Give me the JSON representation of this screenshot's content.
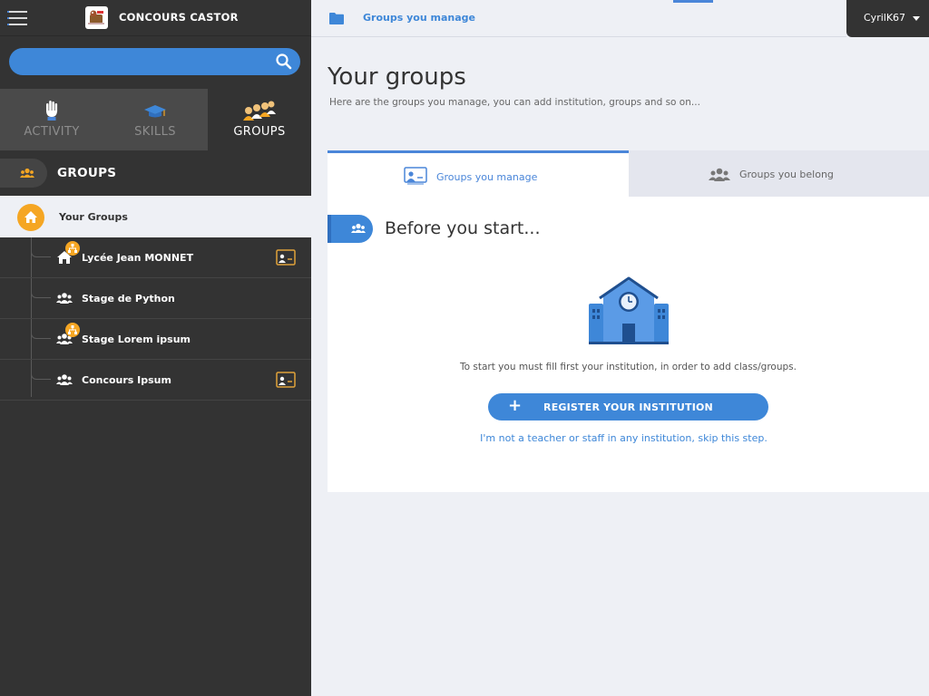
{
  "app": {
    "title": "CONCOURS CASTOR"
  },
  "search": {
    "placeholder": "",
    "value": ""
  },
  "nav_tabs": [
    {
      "label": "ACTIVITY",
      "icon": "hand-icon",
      "active": false
    },
    {
      "label": "SKILLS",
      "icon": "graduation-cap-icon",
      "active": false
    },
    {
      "label": "GROUPS",
      "icon": "people-group-icon",
      "active": true
    }
  ],
  "sidebar_section": {
    "title": "GROUPS"
  },
  "your_groups": {
    "label": "Your Groups"
  },
  "tree_items": [
    {
      "label": "Lycée Jean MONNET",
      "icon": "home-icon",
      "has_badge": true,
      "has_board": true
    },
    {
      "label": "Stage de Python",
      "icon": "users-icon",
      "has_badge": false,
      "has_board": false
    },
    {
      "label": "Stage Lorem ipsum",
      "icon": "users-icon",
      "has_badge": true,
      "has_board": false
    },
    {
      "label": "Concours Ipsum",
      "icon": "users-icon",
      "has_badge": false,
      "has_board": true
    }
  ],
  "breadcrumb": {
    "label": "Groups you manage"
  },
  "user": {
    "name": "CyrilK67"
  },
  "page": {
    "title": "Your groups",
    "subtitle": "Here are the groups you manage, you can add institution, groups and so on..."
  },
  "content_tabs": [
    {
      "label": "Groups you manage",
      "active": true
    },
    {
      "label": "Groups you belong",
      "active": false
    }
  ],
  "panel": {
    "title": "Before you start...",
    "info": "To start you must fill first your institution, in order to add class/groups.",
    "register_label": "REGISTER YOUR INSTITUTION",
    "skip_label": "I'm not a teacher or staff in any institution, skip this step."
  },
  "colors": {
    "accent": "#3e87d8",
    "sidebar_bg": "#333333",
    "badge_orange": "#f5a623",
    "page_bg": "#eef0f5"
  }
}
